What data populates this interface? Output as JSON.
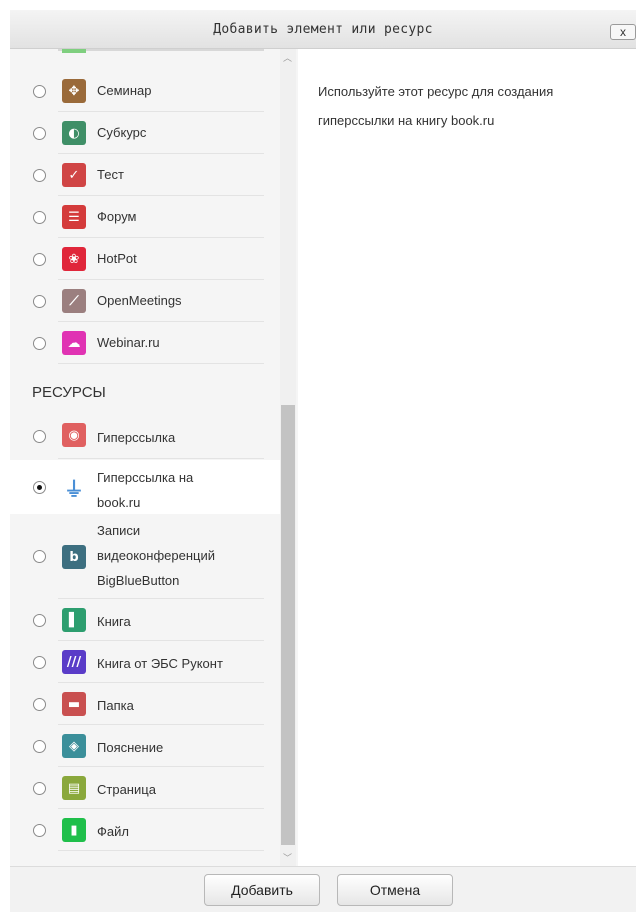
{
  "dialog": {
    "title": "Добавить элемент или ресурс",
    "close_label": "x"
  },
  "activities": [
    {
      "label": "Семинар",
      "icon": "workshop-icon",
      "color": "#9a6a3a",
      "glyph": "✥"
    },
    {
      "label": "Субкурс",
      "icon": "subcourse-icon",
      "color": "#3f8f67",
      "glyph": "◐"
    },
    {
      "label": "Тест",
      "icon": "quiz-icon",
      "color": "#d04545",
      "glyph": "✓"
    },
    {
      "label": "Форум",
      "icon": "forum-icon",
      "color": "#d43b3b",
      "glyph": "☰"
    },
    {
      "label": "HotPot",
      "icon": "hotpot-icon",
      "color": "#e0263a",
      "glyph": "❀"
    },
    {
      "label": "OpenMeetings",
      "icon": "openmeetings-icon",
      "color": "#9b7f7f",
      "glyph": "⟋"
    },
    {
      "label": "Webinar.ru",
      "icon": "webinar-icon",
      "color": "#e033b3",
      "glyph": "☁"
    }
  ],
  "resources_heading": "РЕСУРСЫ",
  "resources": [
    {
      "label": "Гиперссылка",
      "icon": "url-icon",
      "color": "#e06060",
      "glyph": "◉"
    },
    {
      "label": "Гиперссылка на book.ru",
      "icon": "plug-icon",
      "color": "#4a8fd6",
      "glyph": "⏚",
      "selected": true
    },
    {
      "label": "Записи видеоконференций BigBlueButton",
      "icon": "bigbluebutton-icon",
      "color": "#3d6f80",
      "glyph": "b"
    },
    {
      "label": "Книга",
      "icon": "book-icon",
      "color": "#2d9e6f",
      "glyph": "▌"
    },
    {
      "label": "Книга от ЭБС Руконт",
      "icon": "rucont-book-icon",
      "color": "#5a3cc8",
      "glyph": "///"
    },
    {
      "label": "Папка",
      "icon": "folder-icon",
      "color": "#c95050",
      "glyph": "▬"
    },
    {
      "label": "Пояснение",
      "icon": "label-icon",
      "color": "#3b8f9a",
      "glyph": "◈"
    },
    {
      "label": "Страница",
      "icon": "page-icon",
      "color": "#8aa83c",
      "glyph": "▤"
    },
    {
      "label": "Файл",
      "icon": "file-icon",
      "color": "#1fbf4a",
      "glyph": "▮"
    }
  ],
  "description": "Используйте этот ресурс для создания гиперссылки на книгу book.ru",
  "buttons": {
    "add": "Добавить",
    "cancel": "Отмена"
  }
}
